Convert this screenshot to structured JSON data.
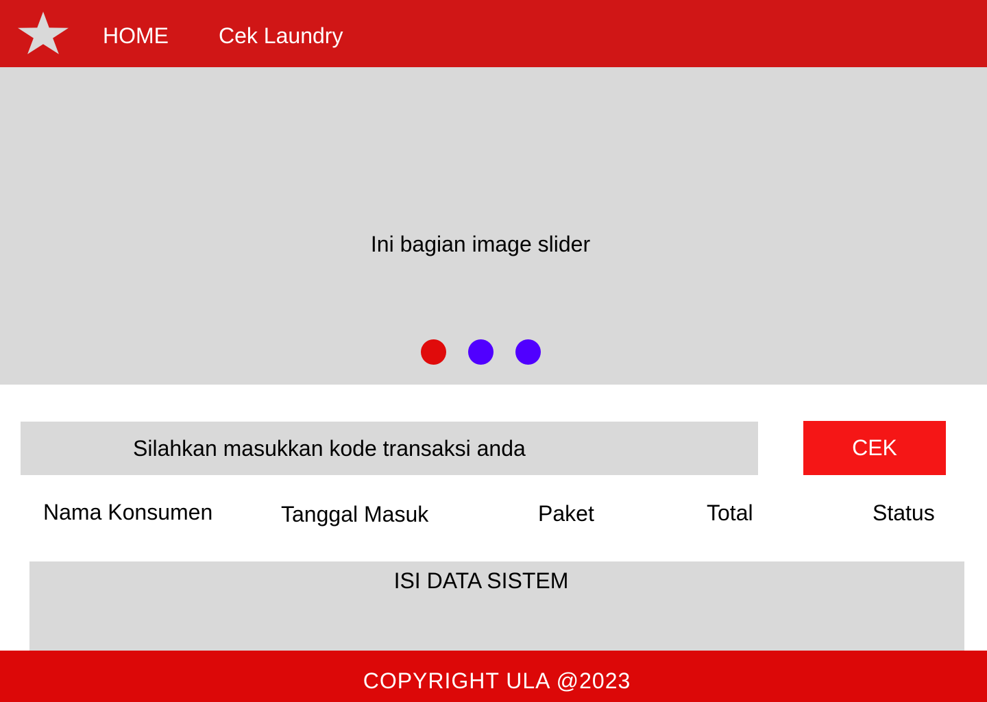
{
  "navbar": {
    "logo_icon": "star-icon",
    "background": "#d01616",
    "links": [
      {
        "label": "HOME"
      },
      {
        "label": "Cek Laundry"
      }
    ]
  },
  "slider": {
    "text": "Ini bagian image slider",
    "active_index": 0,
    "dots": [
      {
        "color": "#e00b0b",
        "active": true
      },
      {
        "color": "#5000ff",
        "active": false
      },
      {
        "color": "#5000ff",
        "active": false
      }
    ]
  },
  "search": {
    "placeholder": "Silahkan masukkan kode transaksi anda",
    "value": "",
    "button_label": "CEK",
    "button_color": "#f51616"
  },
  "table": {
    "headers": [
      "Nama Konsumen",
      "Tanggal Masuk",
      "Paket",
      "Total",
      "Status"
    ],
    "body_text": "ISI DATA SISTEM"
  },
  "footer": {
    "text": "COPYRIGHT ULA @2023",
    "background": "#dc0808"
  }
}
